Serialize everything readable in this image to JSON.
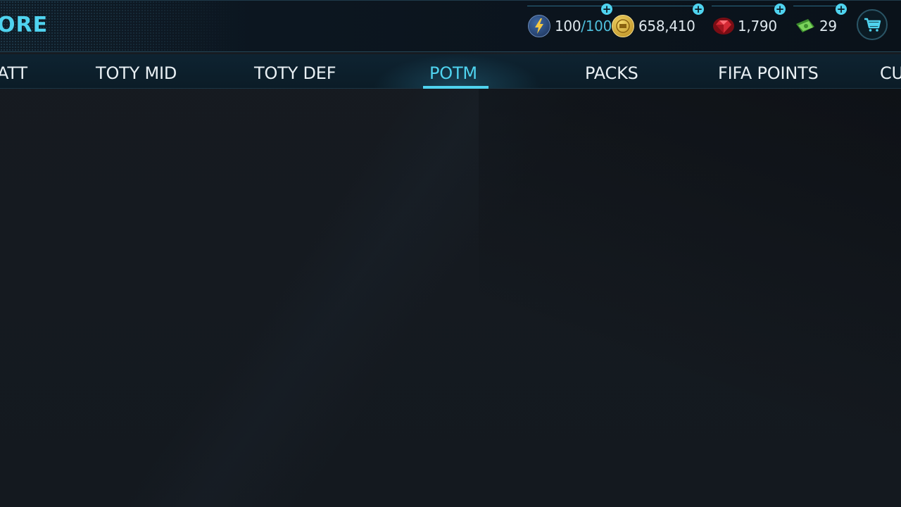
{
  "header": {
    "title": "ORE"
  },
  "currencies": {
    "energy": {
      "icon": "energy-icon",
      "current": "100",
      "max": "/100"
    },
    "coins": {
      "icon": "coin-icon",
      "value": "658,410"
    },
    "gems": {
      "icon": "gem-icon",
      "value": "1,790"
    },
    "cash": {
      "icon": "cash-icon",
      "value": "29"
    },
    "add_label": "+"
  },
  "nav": {
    "tabs": [
      {
        "label": "ATT"
      },
      {
        "label": "TOTY MID"
      },
      {
        "label": "TOTY DEF"
      },
      {
        "label": "POTM",
        "active": true
      },
      {
        "label": "PACKS"
      },
      {
        "label": "FIFA POINTS"
      },
      {
        "label": "CU"
      }
    ]
  },
  "colors": {
    "accent": "#4fd3ef",
    "background": "#141920"
  }
}
